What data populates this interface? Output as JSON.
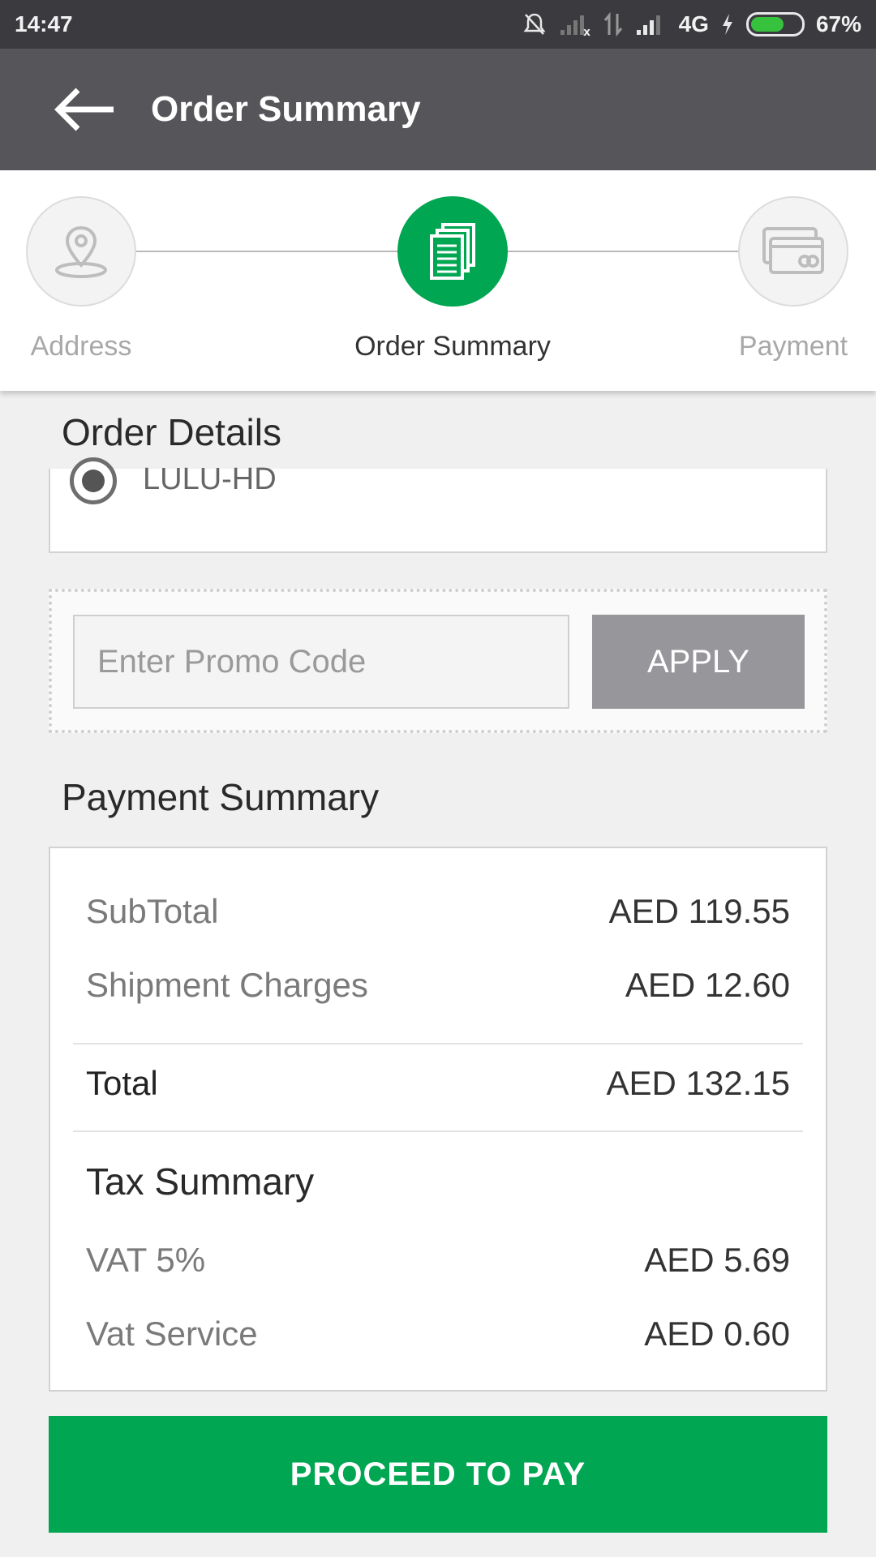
{
  "status_bar": {
    "time": "14:47",
    "network": "4G",
    "battery": "67%",
    "battery_level": 0.67
  },
  "app_bar": {
    "title": "Order Summary"
  },
  "stepper": {
    "steps": [
      {
        "label": "Address",
        "icon": "location-pin-icon",
        "state": "inactive"
      },
      {
        "label": "Order Summary",
        "icon": "documents-icon",
        "state": "active"
      },
      {
        "label": "Payment",
        "icon": "credit-card-icon",
        "state": "inactive"
      }
    ]
  },
  "order_details": {
    "heading": "Order Details",
    "shipping_option": "LULU-HD"
  },
  "promo": {
    "placeholder": "Enter Promo Code",
    "apply_label": "APPLY"
  },
  "payment_summary": {
    "heading": "Payment Summary",
    "subtotal_label": "SubTotal",
    "subtotal_value": "AED 119.55",
    "shipment_label": "Shipment Charges",
    "shipment_value": "AED 12.60",
    "total_label": "Total",
    "total_value": "AED 132.15",
    "tax_heading": "Tax Summary",
    "vat_label": "VAT 5%",
    "vat_value": "AED 5.69",
    "vat_service_label": "Vat Service",
    "vat_service_value": "AED 0.60"
  },
  "cta": {
    "label": "PROCEED TO PAY"
  },
  "colors": {
    "accent": "#00a651",
    "app_bar": "#56565a",
    "status_bar": "#3a3a3f",
    "apply_button": "#96969b"
  }
}
